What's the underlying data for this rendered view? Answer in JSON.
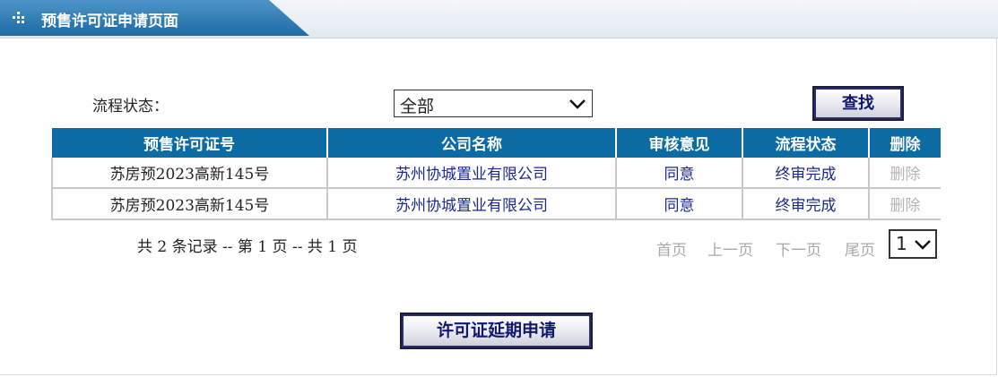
{
  "header": {
    "title": "预售许可证申请页面",
    "icon": "grid-dots-icon"
  },
  "filter": {
    "label": "流程状态：",
    "selected": "全部",
    "search_label": "查找"
  },
  "table": {
    "columns": [
      "预售许可证号",
      "公司名称",
      "审核意见",
      "流程状态",
      "删除"
    ],
    "rows": [
      {
        "permit_no": "苏房预2023高新145号",
        "company": "苏州协城置业有限公司",
        "opinion": "同意",
        "status": "终审完成",
        "delete": "删除"
      },
      {
        "permit_no": "苏房预2023高新145号",
        "company": "苏州协城置业有限公司",
        "opinion": "同意",
        "status": "终审完成",
        "delete": "删除"
      }
    ]
  },
  "pager": {
    "info": "共 2 条记录 -- 第 1 页 -- 共 1 页",
    "first": "首页",
    "prev": "上一页",
    "next": "下一页",
    "last": "尾页",
    "page_selected": "1"
  },
  "actions": {
    "extend_label": "许可证延期申请"
  },
  "colors": {
    "header_bg": "#0d6ba3",
    "link": "#1a2a8c",
    "disabled": "#b4b4b4"
  }
}
